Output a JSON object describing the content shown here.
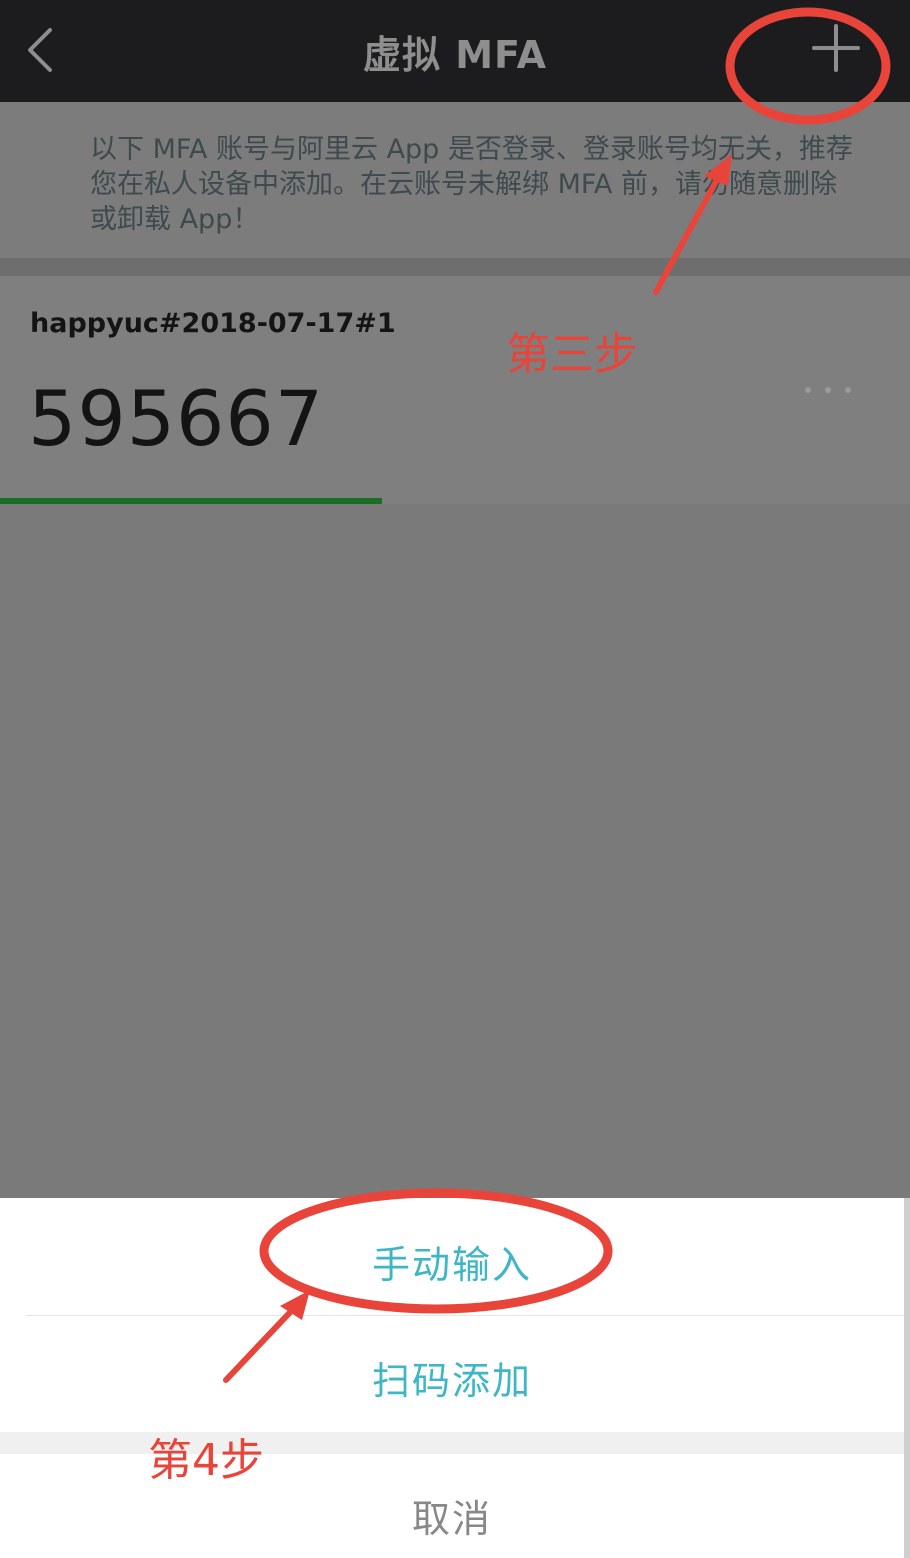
{
  "nav": {
    "title": "虚拟 MFA"
  },
  "notice": {
    "text": "以下 MFA 账号与阿里云 App 是否登录、登录账号均无关，推荐您在私人设备中添加。在云账号未解绑 MFA 前，请勿随意删除或卸载 App！"
  },
  "account": {
    "name": "happyuc#2018-07-17#1",
    "code": "595667",
    "progress_fraction": 0.42
  },
  "sheet": {
    "manual_label": "手动输入",
    "scan_label": "扫码添加",
    "cancel_label": "取消"
  },
  "annotations": {
    "step3": "第三步",
    "step4": "第4步"
  },
  "colors": {
    "accent": "#3fb6c6",
    "annotation": "#e8443a",
    "progress": "#1d6e25"
  },
  "icons": {
    "back": "chevron-left-icon",
    "add": "plus-icon",
    "info": "info-icon",
    "more": "more-horizontal-icon"
  }
}
